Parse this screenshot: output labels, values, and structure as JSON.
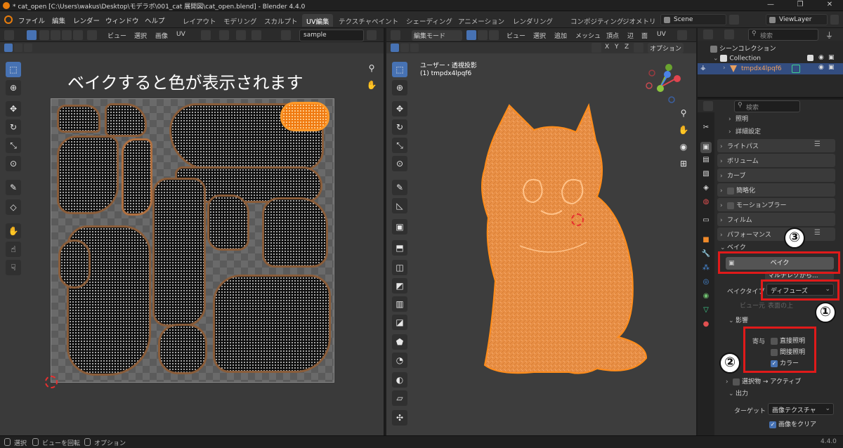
{
  "window": {
    "title": "* cat_open [C:\\Users\\wakus\\Desktop\\モデラボ\\001_cat 展開図\\cat_open.blend] - Blender 4.4.0",
    "minimize": "—",
    "maximize": "❐",
    "close": "✕"
  },
  "menu": {
    "items": [
      "ファイル",
      "編集",
      "レンダー",
      "ウィンドウ",
      "ヘルプ"
    ],
    "workspaces": [
      "レイアウト",
      "モデリング",
      "スカルプト",
      "UV編集",
      "テクスチャペイント",
      "シェーディング",
      "アニメーション",
      "レンダリング",
      "コンポジティング",
      "ジオメトリ"
    ],
    "active_workspace": "UV編集",
    "scene": "Scene",
    "view_layer": "ViewLayer"
  },
  "uv_editor": {
    "header_menus": [
      "ビュー",
      "選択",
      "画像",
      "UV"
    ],
    "image_name": "sample",
    "overlay_text": "ベイクすると色が表示されます"
  },
  "viewport": {
    "mode": "編集モード",
    "header_menus": [
      "ビュー",
      "選択",
      "追加",
      "メッシュ",
      "頂点",
      "辺",
      "面",
      "UV"
    ],
    "axes": [
      "X",
      "Y",
      "Z"
    ],
    "options_label": "オプション",
    "view_name": "ユーザー・透視投影",
    "object_label": "(1) tmpdx4lpqf6",
    "gizmo_axes": [
      "X",
      "Y",
      "Z"
    ]
  },
  "outliner": {
    "search_placeholder": "検索",
    "scene_collection": "シーンコレクション",
    "collection": "Collection",
    "object": "tmpdx4lpqf6"
  },
  "properties": {
    "search_placeholder": "検索",
    "panels": {
      "lighting": "照明",
      "advanced": "詳細設定",
      "light_paths": "ライトパス",
      "volume": "ボリューム",
      "curves": "カーブ",
      "simplify": "簡略化",
      "motion_blur": "モーションブラー",
      "film": "フィルム",
      "performance": "パフォーマンス",
      "bake": "ベイク"
    },
    "bake_button": "ベイク",
    "multires_label": "マルチレゾから...",
    "bake_type_label": "ベイクタイプ",
    "bake_type_value": "ディフューズ",
    "view_from_label": "ビュー元",
    "view_from_value": "表面の上",
    "influence": "影響",
    "contribution_label": "寄与",
    "contributions": [
      {
        "label": "直接照明",
        "checked": false
      },
      {
        "label": "間接照明",
        "checked": false
      },
      {
        "label": "カラー",
        "checked": true
      }
    ],
    "selected_to_active": "選択物 → アクティブ",
    "output": "出力",
    "target_label": "ターゲット",
    "target_value": "画像テクスチャ",
    "clear_image": "画像をクリア",
    "clear_image_checked": true
  },
  "annotations": {
    "one": "①",
    "two": "②",
    "three": "③"
  },
  "statusbar": {
    "select": "選択",
    "rotate_view": "ビューを回転",
    "options": "オプション",
    "version": "4.4.0"
  },
  "colors": {
    "accent": "#4772b3",
    "annotation_red": "#e01a1a",
    "mesh_orange": "#f08a2a"
  }
}
